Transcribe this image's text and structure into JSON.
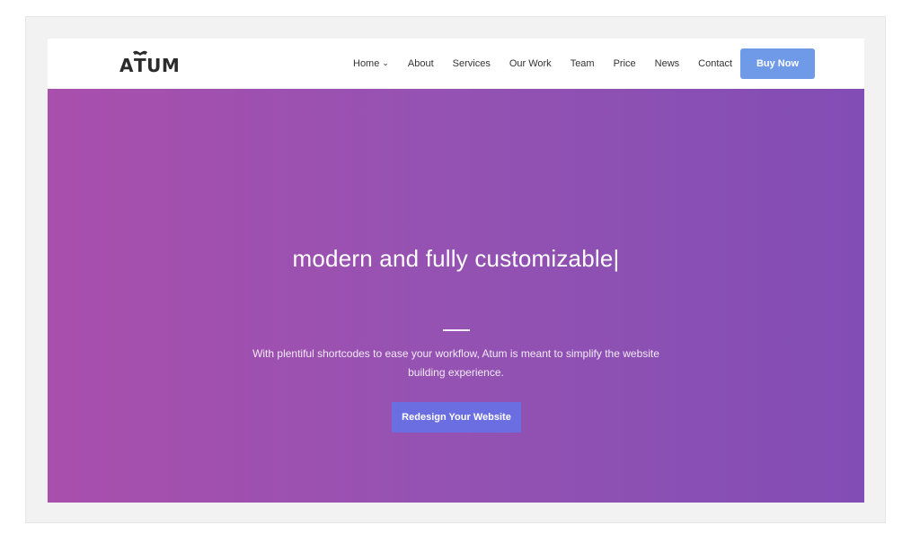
{
  "brand": {
    "logo_text_left": "A",
    "logo_text_t": "T",
    "logo_text_right": "UM",
    "logo_name": "ATUM"
  },
  "nav": {
    "items": [
      {
        "label": "Home",
        "has_dropdown": true
      },
      {
        "label": "About"
      },
      {
        "label": "Services"
      },
      {
        "label": "Our Work"
      },
      {
        "label": "Team"
      },
      {
        "label": "Price"
      },
      {
        "label": "News"
      },
      {
        "label": "Contact"
      }
    ],
    "dropdown_icon": "chevron-down-icon",
    "chevron_glyph": "⌄",
    "buy_label": "Buy Now"
  },
  "hero": {
    "title": "modern and fully customizable",
    "cursor": "|",
    "description": "With plentiful shortcodes to ease your workflow, Atum is meant to simplify the website building experience.",
    "cta_label": "Redesign Your Website"
  },
  "colors": {
    "buy_button": "#6f9ae8",
    "cta_button": "#6a6ee0",
    "hero_gradient_start": "#a94fad",
    "hero_gradient_end": "#824db5",
    "nav_text": "#333333"
  }
}
